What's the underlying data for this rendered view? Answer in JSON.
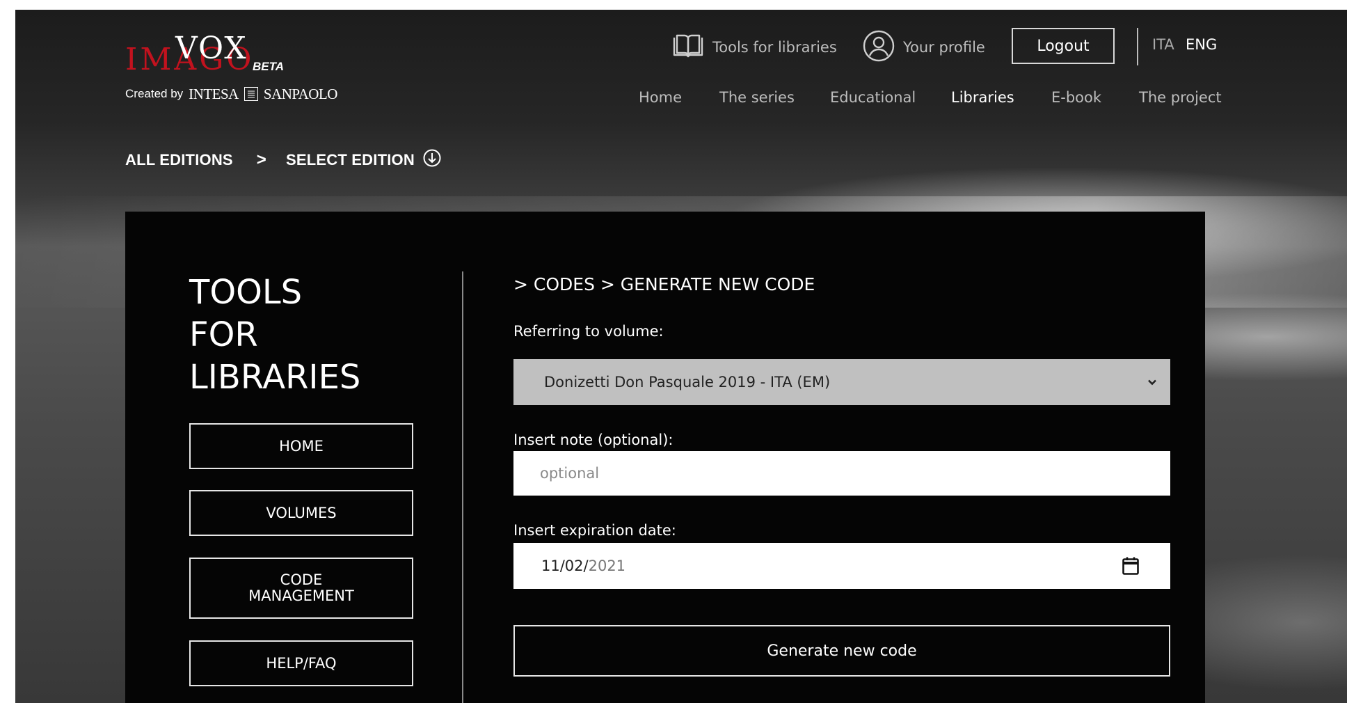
{
  "brand": {
    "logo_top": "VOX",
    "logo_bottom": "IMAGO",
    "logo_badge": "BETA",
    "created_by": "Created by",
    "sponsor_left": "INTESA",
    "sponsor_right": "SANPAOLO"
  },
  "topbar": {
    "tools_label": "Tools for libraries",
    "profile_label": "Your profile",
    "logout_label": "Logout",
    "lang_ita": "ITA",
    "lang_eng": "ENG",
    "active_lang": "ENG"
  },
  "nav": {
    "items": [
      {
        "label": "Home"
      },
      {
        "label": "The series"
      },
      {
        "label": "Educational"
      },
      {
        "label": "Libraries"
      },
      {
        "label": "E-book"
      },
      {
        "label": "The project"
      }
    ],
    "active": "Libraries"
  },
  "breadcrumb": {
    "all_editions": "ALL EDITIONS",
    "separator": ">",
    "select_edition": "SELECT EDITION"
  },
  "sidebar": {
    "title_lines": [
      "TOOLS",
      "FOR",
      "LIBRARIES"
    ],
    "buttons": [
      {
        "label": "HOME"
      },
      {
        "label": "VOLUMES"
      },
      {
        "label_line1": "CODE",
        "label_line2": "MANAGEMENT"
      },
      {
        "label": "HELP/FAQ"
      }
    ]
  },
  "form": {
    "path": "> CODES > GENERATE NEW CODE",
    "volume_label": "Referring to volume:",
    "volume_selected": "Donizetti Don Pasquale 2019 - ITA (EM)",
    "note_label": "Insert note (optional):",
    "note_placeholder": "optional",
    "date_label": "Insert expiration date:",
    "date_day_month": "11/02/",
    "date_year": "2021",
    "submit_label": "Generate new code"
  },
  "colors": {
    "brand_red": "#c2121e",
    "panel_bg": "#050505",
    "select_bg": "#c0c0c0"
  }
}
